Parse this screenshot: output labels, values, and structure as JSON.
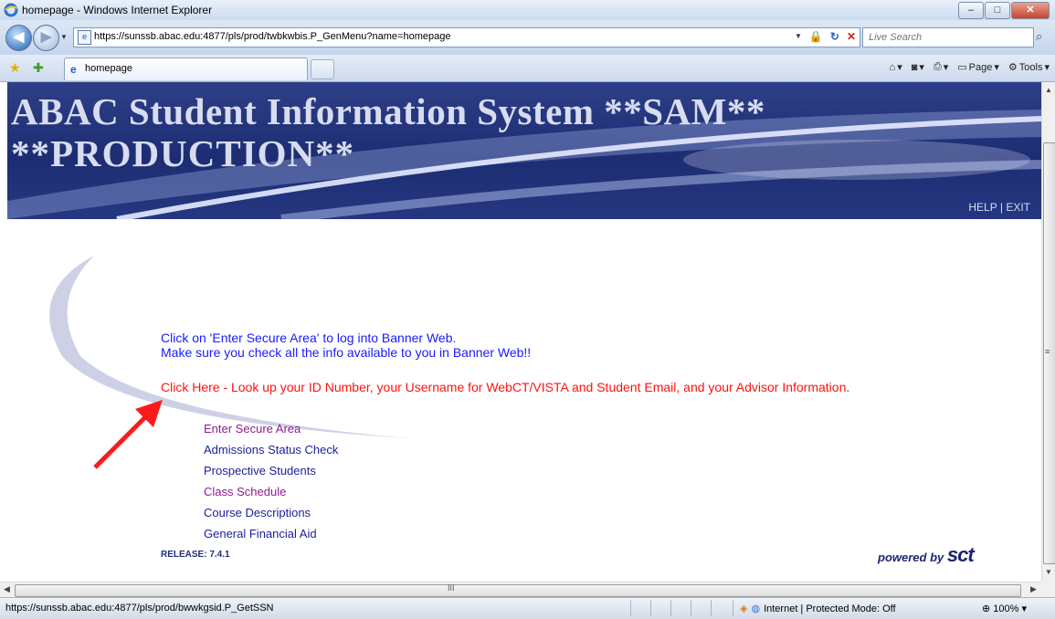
{
  "window": {
    "title": "homepage - Windows Internet Explorer",
    "controls": [
      "–",
      "□",
      "✕"
    ]
  },
  "address": {
    "url": "https://sunssb.abac.edu:4877/pls/prod/twbkwbis.P_GenMenu?name=homepage",
    "search_placeholder": "Live Search"
  },
  "tab": {
    "label": "homepage"
  },
  "command_bar": {
    "page_label": "Page",
    "tools_label": "Tools"
  },
  "banner": {
    "title_line1": "ABAC Student Information System **SAM**",
    "title_line2": "**PRODUCTION**",
    "help": "HELP",
    "separator": "|",
    "exit": "EXIT"
  },
  "main": {
    "info_line1": "Click on 'Enter Secure Area' to log into Banner Web.",
    "info_line2": "Make sure you check all the info available to you in Banner Web!!",
    "lookup_link": "Click Here - Look up your ID Number, your Username for WebCT/VISTA and Student Email, and your Advisor Information.",
    "menu": [
      {
        "label": "Enter Secure Area",
        "visited": true
      },
      {
        "label": "Admissions Status Check",
        "visited": false
      },
      {
        "label": "Prospective Students",
        "visited": false
      },
      {
        "label": "Class Schedule",
        "visited": true
      },
      {
        "label": "Course Descriptions",
        "visited": false
      },
      {
        "label": "General Financial Aid",
        "visited": false
      }
    ],
    "release": "RELEASE: 7.4.1",
    "powered_by": "powered by",
    "powered_brand": "sct"
  },
  "status": {
    "url": "https://sunssb.abac.edu:4877/pls/prod/bwwkgsid.P_GetSSN",
    "zone": "Internet | Protected Mode: Off",
    "zoom": "100%"
  },
  "colors": {
    "banner_bg": "#1d2d73",
    "info_text": "#1a1aff",
    "lookup_text": "#ff1111",
    "menu_link": "#1d1d9a",
    "menu_visited": "#8e1c8e",
    "annotation_arrow": "#ff1a1a"
  }
}
